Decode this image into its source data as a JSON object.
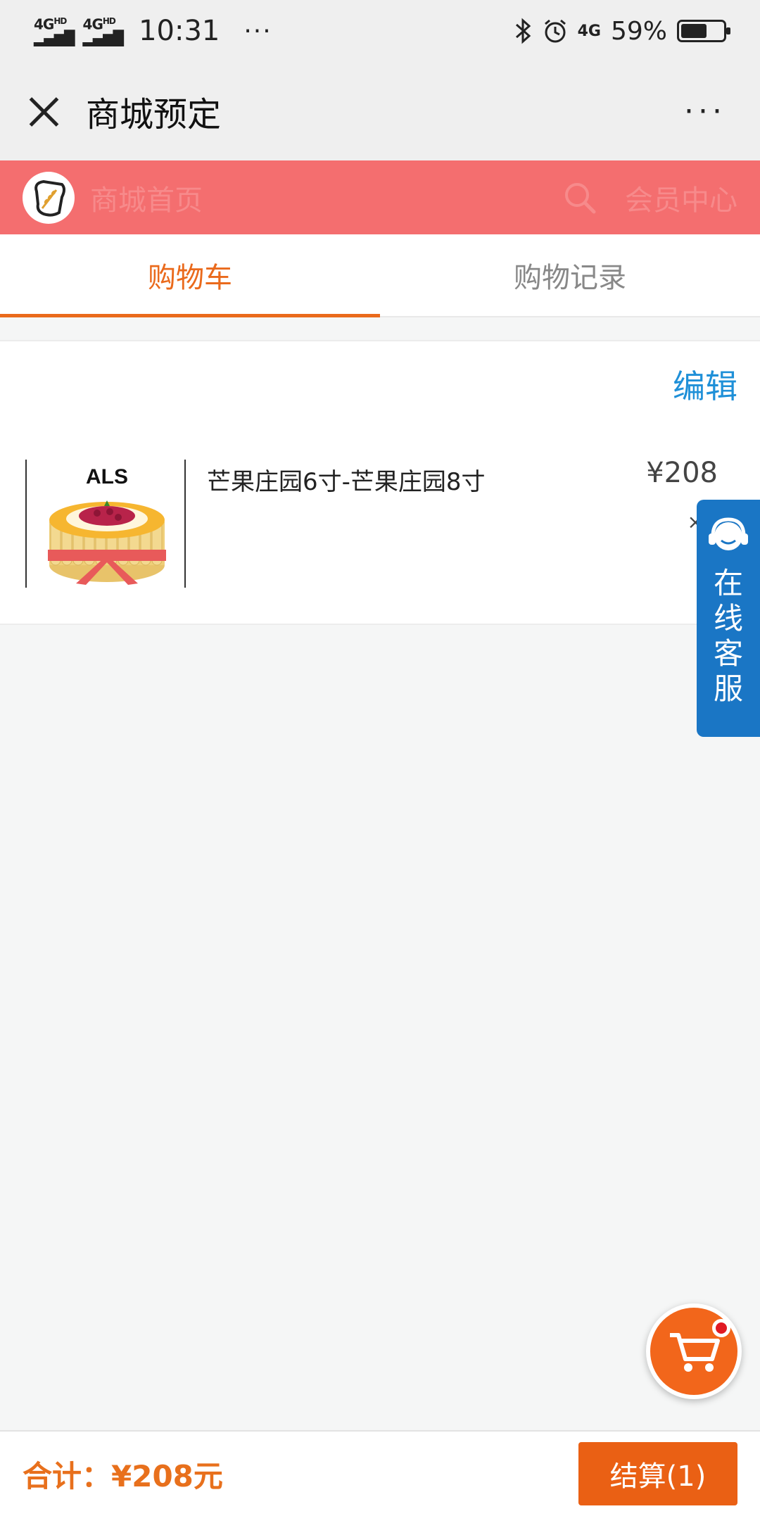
{
  "status_bar": {
    "signal_1": "4G",
    "signal_1_sup": "HD",
    "signal_2": "4G",
    "signal_2_sup": "HD",
    "time": "10:31",
    "dots": "···",
    "network": "4G",
    "battery": "59%",
    "battery_level": 0.59
  },
  "title_bar": {
    "title": "商城预定",
    "more": "···"
  },
  "shop_bar": {
    "home_label": "商城首页",
    "member_label": "会员中心"
  },
  "tabs": [
    {
      "label": "购物车",
      "active": true
    },
    {
      "label": "购物记录",
      "active": false
    }
  ],
  "cart": {
    "edit_label": "编辑",
    "items": [
      {
        "brand": "ALS",
        "name": "芒果庄园6寸-芒果庄园8寸",
        "price": "¥208",
        "quantity": "×"
      }
    ]
  },
  "service": {
    "label": "在线客服"
  },
  "footer": {
    "total_label": "合计：",
    "total_value": "¥208元",
    "checkout_label": "结算(1)"
  },
  "colors": {
    "accent": "#ea6a1c",
    "shop_bar": "#f46e6f",
    "link": "#1f90d8",
    "service": "#1a76c5"
  }
}
